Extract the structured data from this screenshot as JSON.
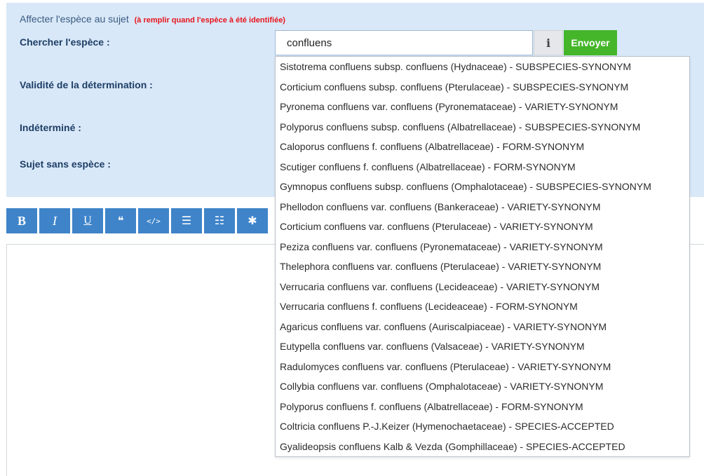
{
  "panel": {
    "title": "Affecter l'espèce au sujet",
    "warning": "(à remplir quand l'espèce à été identifiée)",
    "labels": {
      "search": "Chercher l'espèce :",
      "validity": "Validité de la détermination :",
      "undetermined": "Indéterminé :",
      "no_species": "Sujet sans espèce :"
    }
  },
  "search": {
    "value": "confluens",
    "info_label": "i",
    "send_label": "Envoyer"
  },
  "toolbar": {
    "bold": "B",
    "italic": "I",
    "underline": "U",
    "quote": "❝",
    "code": "</>",
    "bullet_list": "☰",
    "numbered_list": "☷",
    "asterisk": "✱"
  },
  "colors": {
    "panel_bg": "#d8e8f8",
    "send_button": "#45b62a",
    "toolbar_button": "#3f84c9",
    "warning_text": "#e8141c"
  },
  "suggestions": [
    "Sistotrema confluens subsp. confluens (Hydnaceae) - SUBSPECIES-SYNONYM",
    "Corticium confluens subsp. confluens (Pterulaceae) - SUBSPECIES-SYNONYM",
    "Pyronema confluens var. confluens (Pyronemataceae) - VARIETY-SYNONYM",
    "Polyporus confluens subsp. confluens (Albatrellaceae) - SUBSPECIES-SYNONYM",
    "Caloporus confluens f. confluens (Albatrellaceae) - FORM-SYNONYM",
    "Scutiger confluens f. confluens (Albatrellaceae) - FORM-SYNONYM",
    "Gymnopus confluens subsp. confluens (Omphalotaceae) - SUBSPECIES-SYNONYM",
    "Phellodon confluens var. confluens (Bankeraceae) - VARIETY-SYNONYM",
    "Corticium confluens var. confluens (Pterulaceae) - VARIETY-SYNONYM",
    "Peziza confluens var. confluens (Pyronemataceae) - VARIETY-SYNONYM",
    "Thelephora confluens var. confluens (Pterulaceae) - VARIETY-SYNONYM",
    "Verrucaria confluens var. confluens (Lecideaceae) - VARIETY-SYNONYM",
    "Verrucaria confluens f. confluens (Lecideaceae) - FORM-SYNONYM",
    "Agaricus confluens var. confluens (Auriscalpiaceae) - VARIETY-SYNONYM",
    "Eutypella confluens var. confluens (Valsaceae) - VARIETY-SYNONYM",
    "Radulomyces confluens var. confluens (Pterulaceae) - VARIETY-SYNONYM",
    "Collybia confluens var. confluens (Omphalotaceae) - VARIETY-SYNONYM",
    "Polyporus confluens f. confluens (Albatrellaceae) - FORM-SYNONYM",
    "Coltricia confluens P.-J.Keizer (Hymenochaetaceae) - SPECIES-ACCEPTED",
    "Gyalideopsis confluens Kalb & Vezda (Gomphillaceae) - SPECIES-ACCEPTED"
  ]
}
